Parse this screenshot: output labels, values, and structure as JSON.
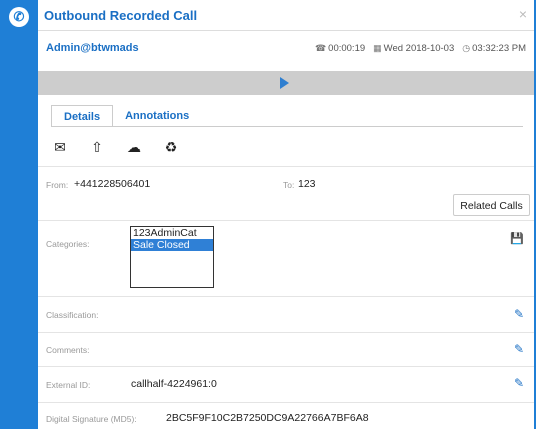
{
  "window": {
    "title": "Outbound Recorded Call",
    "close_glyph": "×"
  },
  "header": {
    "user": "Admin@btwmads",
    "duration": "00:00:19",
    "date": "Wed 2018-10-03",
    "time": "03:32:23 PM"
  },
  "tabs": [
    {
      "label": "Details",
      "active": true
    },
    {
      "label": "Annotations",
      "active": false
    }
  ],
  "action_icons": [
    "envelope-icon",
    "upload-icon",
    "cloud-download-icon",
    "recycle-icon"
  ],
  "call": {
    "from_label": "From:",
    "from_value": "+441228506401",
    "to_label": "To:",
    "to_value": "123",
    "related_calls": "Related Calls"
  },
  "categories": {
    "label": "Categories:",
    "options": [
      {
        "text": "123AdminCat",
        "selected": false
      },
      {
        "text": "Sale Closed",
        "selected": true
      }
    ]
  },
  "fields": {
    "classification_label": "Classification:",
    "comments_label": "Comments:",
    "external_id_label": "External ID:",
    "external_id_value": "callhalf-4224961:0",
    "signature_label": "Digital Signature (MD5):",
    "signature_value": "2BC5F9F10C2B7250DC9A22766A7BF6A8"
  },
  "colors": {
    "accent": "#1f7fd6",
    "title": "#1a6fc4",
    "playbar": "#cdcdcd"
  }
}
